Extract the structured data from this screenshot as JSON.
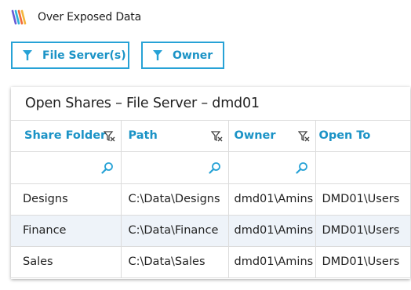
{
  "app": {
    "title": "Over Exposed Data",
    "logo_icon": "stripes-logo-icon"
  },
  "filters": [
    {
      "label": "File Server(s)",
      "icon": "funnel-icon"
    },
    {
      "label": "Owner",
      "icon": "funnel-icon"
    }
  ],
  "panel": {
    "title": "Open Shares – File Server – dmd01",
    "columns": [
      "Share Folder",
      "Path",
      "Owner",
      "Open To"
    ],
    "rows": [
      {
        "share": "Designs",
        "path": "C:\\Data\\Designs",
        "owner": "dmd01\\Amins",
        "open_to": "DMD01\\Users"
      },
      {
        "share": "Finance",
        "path": "C:\\Data\\Finance",
        "owner": "dmd01\\Amins",
        "open_to": "DMD01\\Users"
      },
      {
        "share": "Sales",
        "path": "C:\\Data\\Sales",
        "owner": "dmd01\\Amins",
        "open_to": "DMD01\\Users"
      }
    ]
  },
  "colors": {
    "accent": "#1b93c6",
    "alt_row": "#eef3f9"
  }
}
